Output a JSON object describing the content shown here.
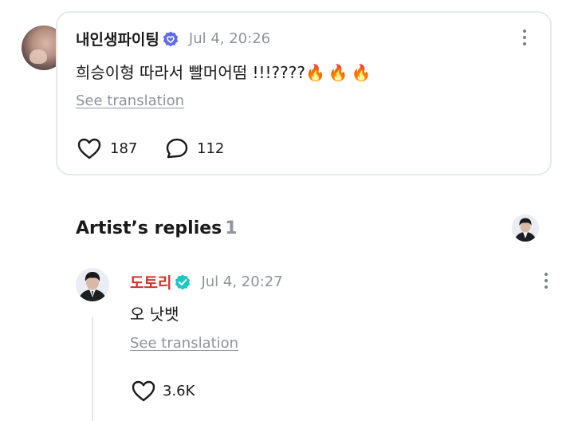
{
  "fan_comment": {
    "username": "내인생파이팅",
    "timestamp": "Jul 4, 20:26",
    "text": "희승이형 따라서 빨머어떰 !!!????",
    "emojis": "🔥🔥🔥",
    "see_translation": "See translation",
    "like_count": "187",
    "reply_count": "112",
    "badge_color": "#5b6cf0"
  },
  "artist_replies": {
    "title": "Artist’s replies",
    "count": "1"
  },
  "artist_reply": {
    "username": "도토리",
    "timestamp": "Jul 4, 20:27",
    "text": "오 낫뱃",
    "see_translation": "See translation",
    "like_count": "3.6K",
    "name_color": "#d2322d",
    "badge_color": "#1cc8c3"
  }
}
